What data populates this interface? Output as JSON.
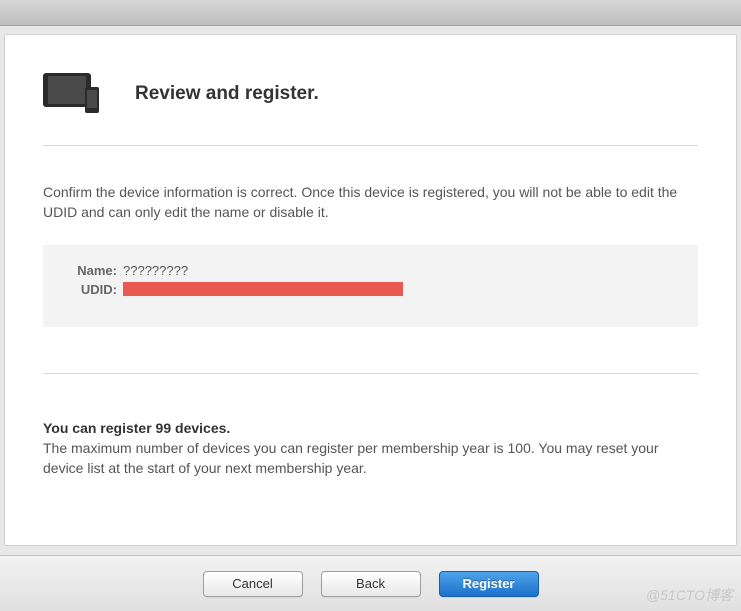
{
  "header": {
    "title": "Review and register."
  },
  "body": {
    "confirm_text": "Confirm the device information is correct. Once this device is registered, you will not be able to edit the UDID and can only edit the name or disable it."
  },
  "device": {
    "name_label": "Name:",
    "name_value": "?????????",
    "udid_label": "UDID:",
    "udid_value": ""
  },
  "limits": {
    "heading": "You can register 99 devices.",
    "text": "The maximum number of devices you can register per membership year is 100. You may reset your device list at the start of your next membership year."
  },
  "buttons": {
    "cancel": "Cancel",
    "back": "Back",
    "register": "Register"
  },
  "watermark": "@51CTO博客"
}
